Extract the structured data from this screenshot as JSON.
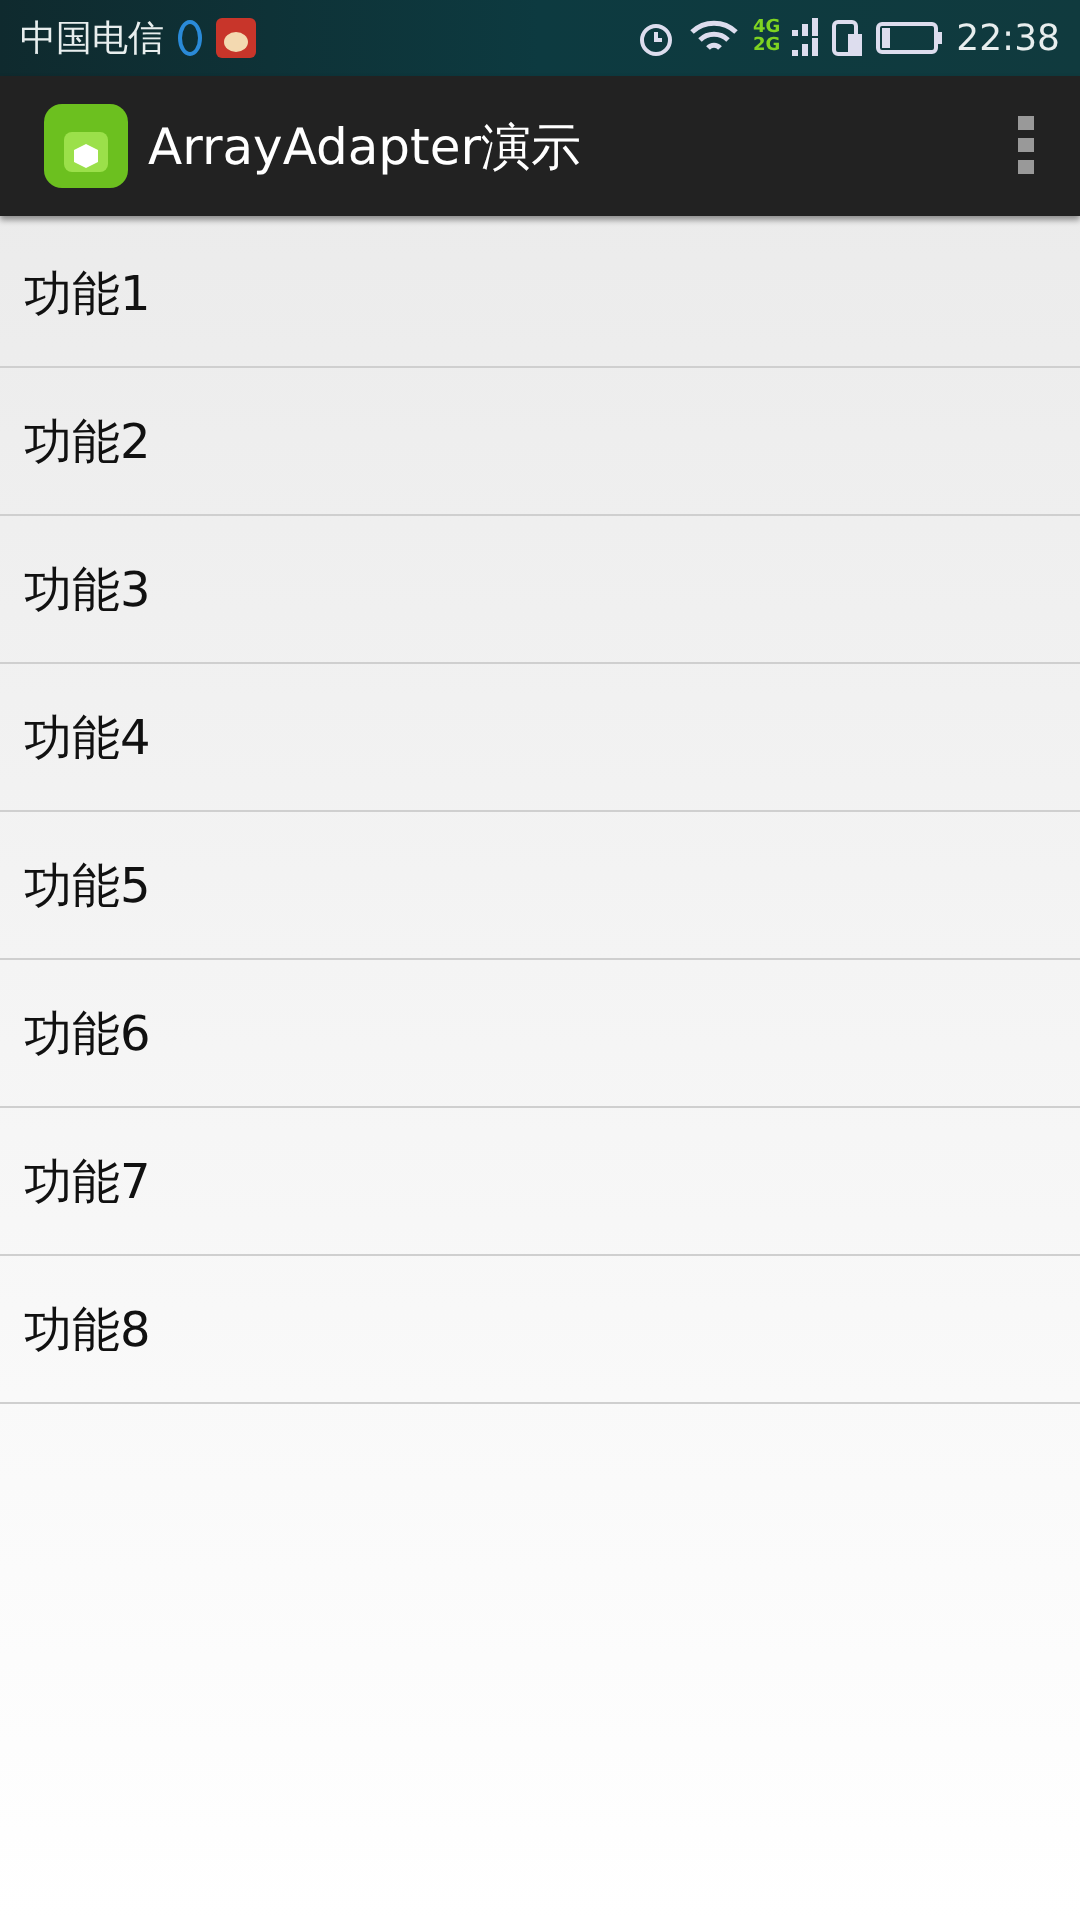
{
  "status_bar": {
    "carrier": "中国电信",
    "network_top": "4G",
    "network_bottom": "2G",
    "time": "22:38"
  },
  "app_bar": {
    "title": "ArrayAdapter演示"
  },
  "list": {
    "items": [
      {
        "label": "功能1"
      },
      {
        "label": "功能2"
      },
      {
        "label": "功能3"
      },
      {
        "label": "功能4"
      },
      {
        "label": "功能5"
      },
      {
        "label": "功能6"
      },
      {
        "label": "功能7"
      },
      {
        "label": "功能8"
      }
    ]
  }
}
